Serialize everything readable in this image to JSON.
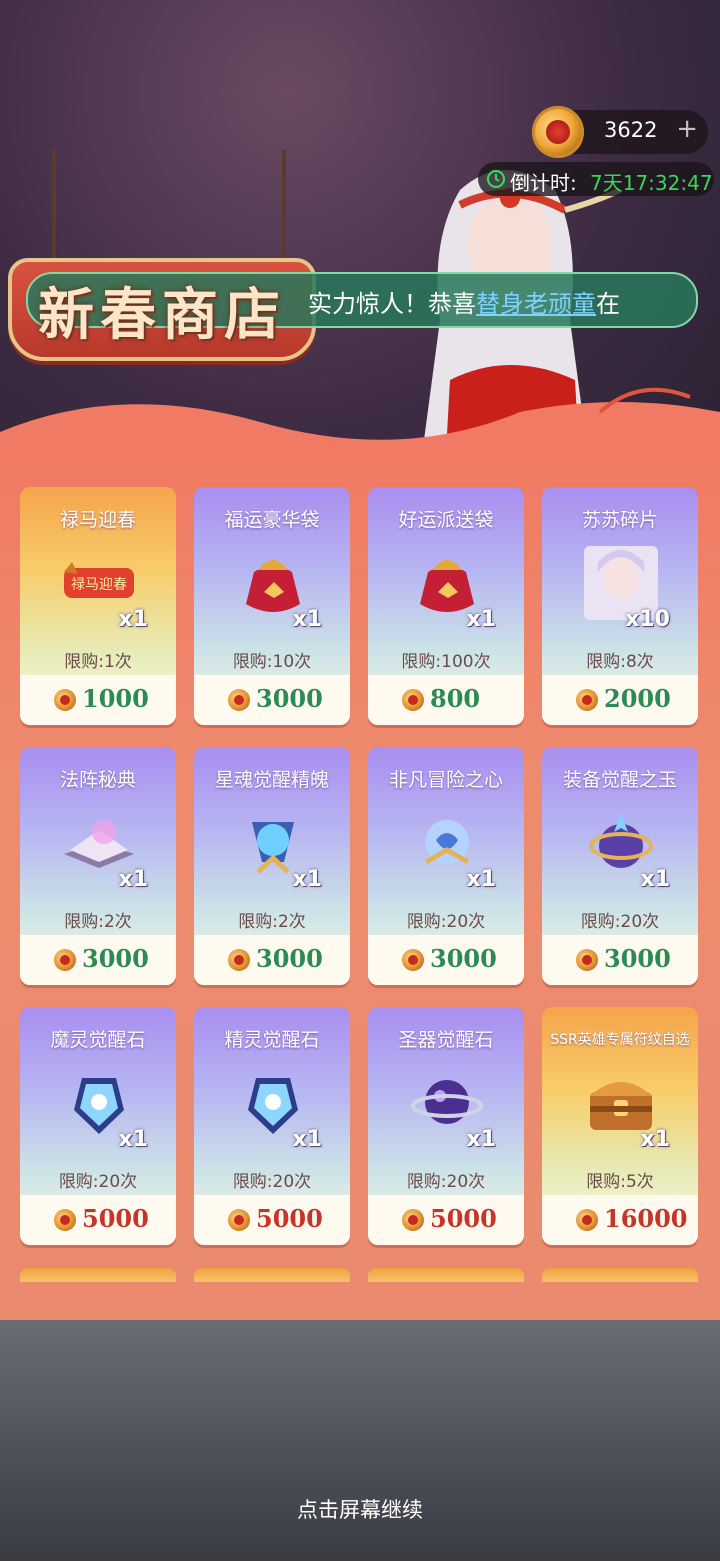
{
  "header": {
    "currency_value": "3622",
    "plus": "+",
    "countdown_label": "倒计时:",
    "countdown_value": "7天17:32:47"
  },
  "shop": {
    "title": "新春商店"
  },
  "marquee": {
    "prefix": "实力惊人！恭喜",
    "name": "替身老顽童",
    "suffix": "在"
  },
  "items": [
    {
      "name": "禄马迎春",
      "qty": "x1",
      "limit": "限购:1次",
      "price": "1000",
      "price_color": "green",
      "icon": "banner-icon"
    },
    {
      "name": "福运豪华袋",
      "qty": "x1",
      "limit": "限购:10次",
      "price": "3000",
      "price_color": "green",
      "icon": "lucky-bag-icon"
    },
    {
      "name": "好运派送袋",
      "qty": "x1",
      "limit": "限购:100次",
      "price": "800",
      "price_color": "green",
      "icon": "lucky-bag-icon"
    },
    {
      "name": "苏苏碎片",
      "qty": "x10",
      "limit": "限购:8次",
      "price": "2000",
      "price_color": "green",
      "icon": "hero-portrait-icon"
    },
    {
      "name": "法阵秘典",
      "qty": "x1",
      "limit": "限购:2次",
      "price": "3000",
      "price_color": "green",
      "icon": "spellbook-icon"
    },
    {
      "name": "星魂觉醒精魄",
      "qty": "x1",
      "limit": "限购:2次",
      "price": "3000",
      "price_color": "green",
      "icon": "crystal-orb-icon"
    },
    {
      "name": "非凡冒险之心",
      "qty": "x1",
      "limit": "限购:20次",
      "price": "3000",
      "price_color": "green",
      "icon": "crystal-heart-icon"
    },
    {
      "name": "装备觉醒之玉",
      "qty": "x1",
      "limit": "限购:20次",
      "price": "3000",
      "price_color": "green",
      "icon": "jade-orb-icon"
    },
    {
      "name": "魔灵觉醒石",
      "qty": "x1",
      "limit": "限购:20次",
      "price": "5000",
      "price_color": "red",
      "icon": "awakening-stone-icon"
    },
    {
      "name": "精灵觉醒石",
      "qty": "x1",
      "limit": "限购:20次",
      "price": "5000",
      "price_color": "red",
      "icon": "awakening-stone-icon"
    },
    {
      "name": "圣器觉醒石",
      "qty": "x1",
      "limit": "限购:20次",
      "price": "5000",
      "price_color": "red",
      "icon": "planet-orb-icon"
    },
    {
      "name": "SSR英雄专属符纹自选",
      "qty": "x1",
      "limit": "限购:5次",
      "price": "16000",
      "price_color": "red",
      "icon": "treasure-chest-icon"
    }
  ],
  "footer": {
    "continue_text": "点击屏幕继续"
  },
  "colors": {
    "accent_green": "#3cd45a",
    "price_green": "#2c8a54",
    "price_red": "#c4352a",
    "panel": "#ee8b6f"
  }
}
